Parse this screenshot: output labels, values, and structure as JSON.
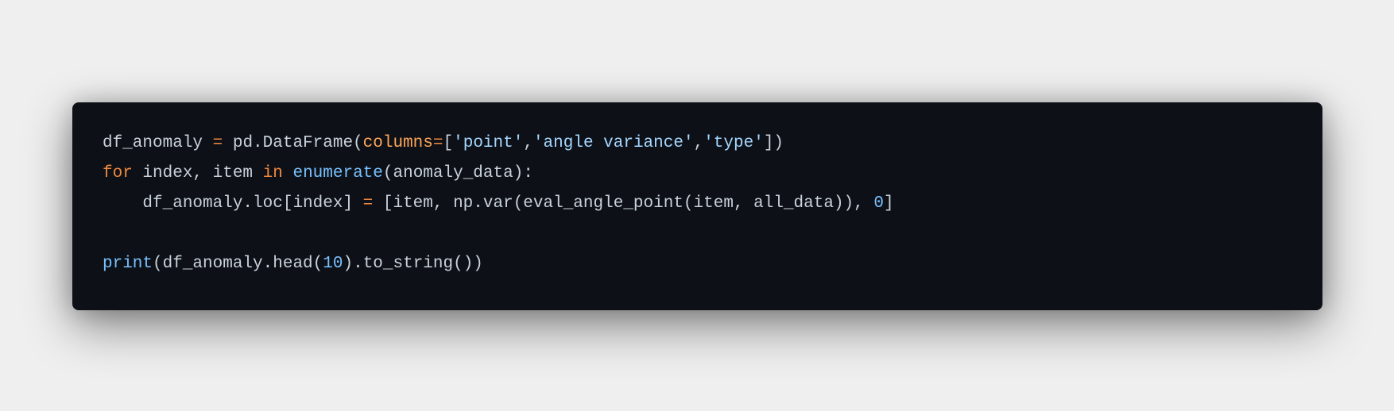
{
  "code_block": {
    "language": "python",
    "lines": [
      [
        {
          "t": "plain",
          "v": "df_anomaly "
        },
        {
          "t": "op",
          "v": "="
        },
        {
          "t": "plain",
          "v": " pd.DataFrame("
        },
        {
          "t": "param",
          "v": "columns"
        },
        {
          "t": "op",
          "v": "="
        },
        {
          "t": "plain",
          "v": "["
        },
        {
          "t": "str",
          "v": "'point'"
        },
        {
          "t": "plain",
          "v": ","
        },
        {
          "t": "str",
          "v": "'angle variance'"
        },
        {
          "t": "plain",
          "v": ","
        },
        {
          "t": "str",
          "v": "'type'"
        },
        {
          "t": "plain",
          "v": "])"
        }
      ],
      [
        {
          "t": "kw",
          "v": "for"
        },
        {
          "t": "plain",
          "v": " index, item "
        },
        {
          "t": "kw",
          "v": "in"
        },
        {
          "t": "plain",
          "v": " "
        },
        {
          "t": "fn",
          "v": "enumerate"
        },
        {
          "t": "plain",
          "v": "(anomaly_data):"
        }
      ],
      [
        {
          "t": "plain",
          "v": "    df_anomaly.loc[index] "
        },
        {
          "t": "op",
          "v": "="
        },
        {
          "t": "plain",
          "v": " [item, np.var(eval_angle_point(item, all_data)), "
        },
        {
          "t": "num",
          "v": "0"
        },
        {
          "t": "plain",
          "v": "]"
        }
      ],
      [],
      [
        {
          "t": "fn",
          "v": "print"
        },
        {
          "t": "plain",
          "v": "(df_anomaly.head("
        },
        {
          "t": "num",
          "v": "10"
        },
        {
          "t": "plain",
          "v": ").to_string())"
        }
      ]
    ]
  }
}
